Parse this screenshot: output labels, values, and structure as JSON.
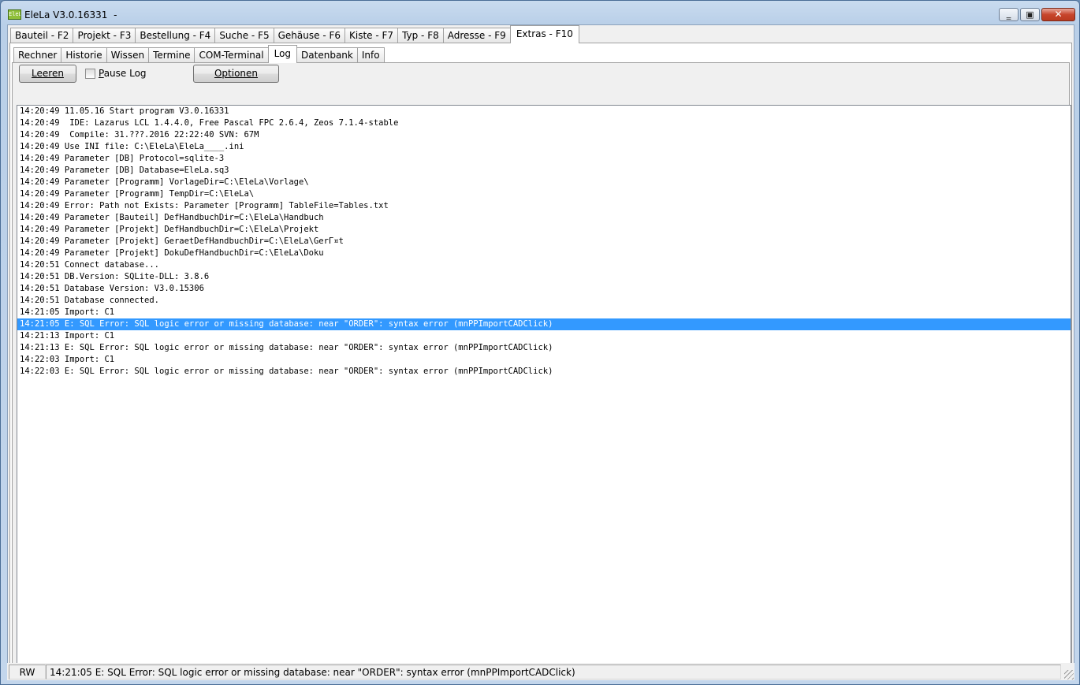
{
  "window": {
    "title": "EleLa V3.0.16331  -",
    "icon_text": "EleLa",
    "icon_name": "elela-app-icon",
    "minimize_symbol": "‗",
    "maximize_symbol": "▣",
    "close_symbol": "✕"
  },
  "main_tabs": [
    {
      "label": "Bauteil - F2",
      "active": false
    },
    {
      "label": "Projekt - F3",
      "active": false
    },
    {
      "label": "Bestellung - F4",
      "active": false
    },
    {
      "label": "Suche - F5",
      "active": false
    },
    {
      "label": "Gehäuse - F6",
      "active": false
    },
    {
      "label": "Kiste - F7",
      "active": false
    },
    {
      "label": "Typ - F8",
      "active": false
    },
    {
      "label": "Adresse - F9",
      "active": false
    },
    {
      "label": "Extras - F10",
      "active": true
    }
  ],
  "sub_tabs": [
    {
      "label": "Rechner",
      "active": false
    },
    {
      "label": "Historie",
      "active": false
    },
    {
      "label": "Wissen",
      "active": false
    },
    {
      "label": "Termine",
      "active": false
    },
    {
      "label": "COM-Terminal",
      "active": false
    },
    {
      "label": "Log",
      "active": true
    },
    {
      "label": "Datenbank",
      "active": false
    },
    {
      "label": "Info",
      "active": false
    }
  ],
  "toolbar": {
    "clear_label": "Leeren",
    "pause_label_key": "P",
    "pause_label_rest": "ause Log",
    "pause_checked": false,
    "options_label": "Optionen"
  },
  "log": {
    "selected_index": 18,
    "lines": [
      "14:20:49 11.05.16 Start program V3.0.16331",
      "14:20:49  IDE: Lazarus LCL 1.4.4.0, Free Pascal FPC 2.6.4, Zeos 7.1.4-stable",
      "14:20:49  Compile: 31.???.2016 22:22:40 SVN: 67M",
      "14:20:49 Use INI file: C:\\EleLa\\EleLa____.ini",
      "14:20:49 Parameter [DB] Protocol=sqlite-3",
      "14:20:49 Parameter [DB] Database=EleLa.sq3",
      "14:20:49 Parameter [Programm] VorlageDir=C:\\EleLa\\Vorlage\\",
      "14:20:49 Parameter [Programm] TempDir=C:\\EleLa\\",
      "14:20:49 Error: Path not Exists: Parameter [Programm] TableFile=Tables.txt",
      "14:20:49 Parameter [Bauteil] DefHandbuchDir=C:\\EleLa\\Handbuch",
      "14:20:49 Parameter [Projekt] DefHandbuchDir=C:\\EleLa\\Projekt",
      "14:20:49 Parameter [Projekt] GeraetDefHandbuchDir=C:\\EleLa\\GerГ¤t",
      "14:20:49 Parameter [Projekt] DokuDefHandbuchDir=C:\\EleLa\\Doku",
      "14:20:51 Connect database...",
      "14:20:51 DB.Version: SQLite-DLL: 3.8.6",
      "14:20:51 Database Version: V3.0.15306",
      "14:20:51 Database connected.",
      "14:21:05 Import: C1",
      "14:21:05 E: SQL Error: SQL logic error or missing database: near \"ORDER\": syntax error (mnPPImportCADClick)",
      "14:21:13 Import: C1",
      "14:21:13 E: SQL Error: SQL logic error or missing database: near \"ORDER\": syntax error (mnPPImportCADClick)",
      "14:22:03 Import: C1",
      "14:22:03 E: SQL Error: SQL logic error or missing database: near \"ORDER\": syntax error (mnPPImportCADClick)"
    ]
  },
  "status": {
    "mode": "RW",
    "message": "14:21:05 E: SQL Error: SQL logic error or missing database: near \"ORDER\": syntax error (mnPPImportCADClick)"
  },
  "colors": {
    "selection": "#3399ff",
    "title_gradient_top": "#c9dbef",
    "close_button": "#c7452c"
  }
}
